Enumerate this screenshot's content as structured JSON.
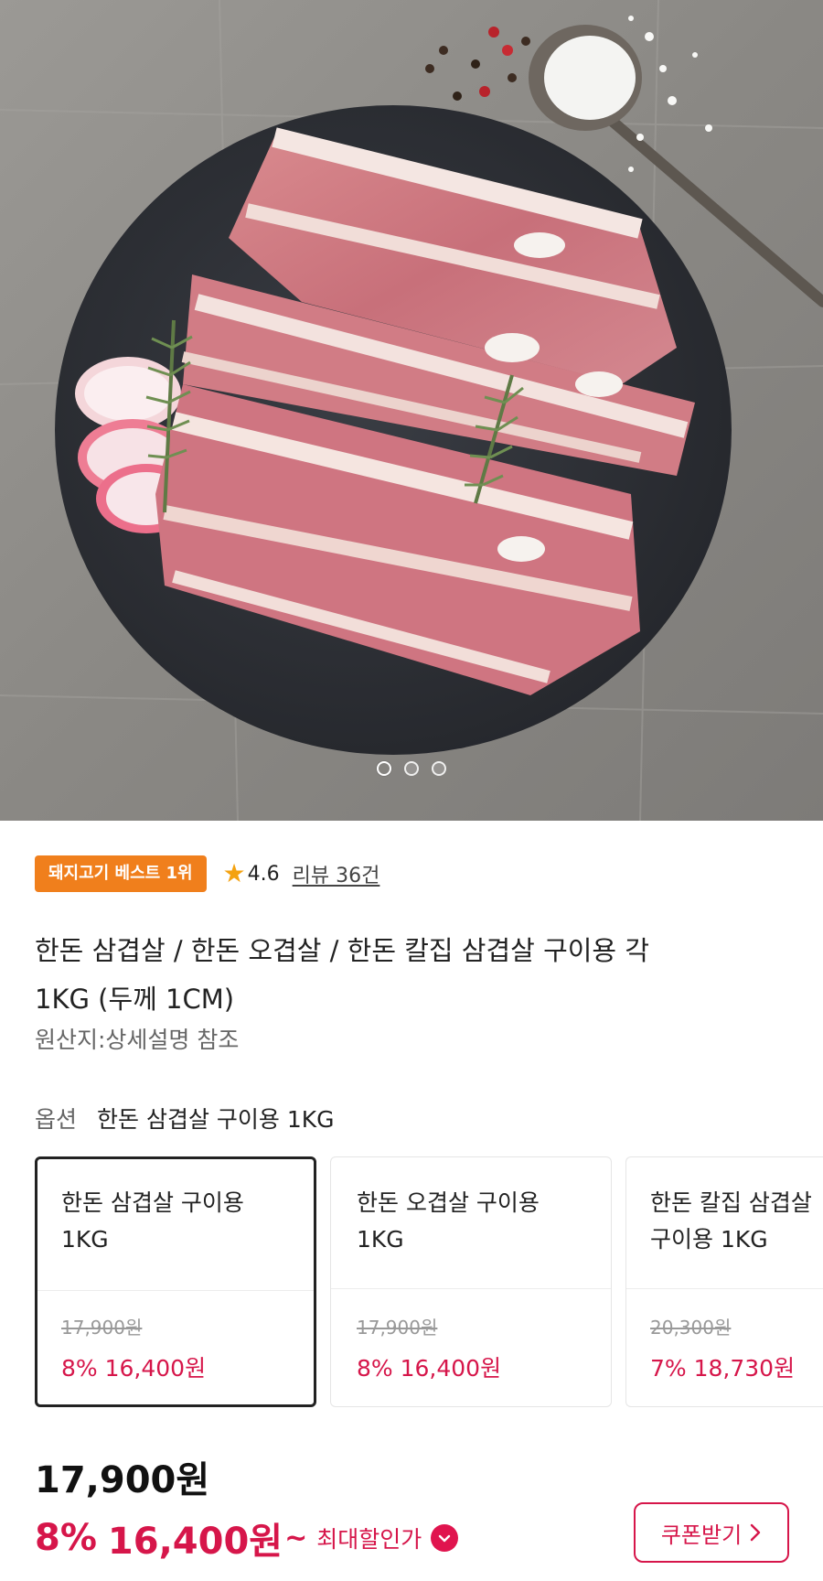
{
  "gallery": {
    "image_alt": "grilled pork belly on slate plate",
    "dots": [
      true,
      false,
      false
    ]
  },
  "product": {
    "badge": "돼지고기 베스트 1위",
    "rating": "4.6",
    "review_link": "리뷰 36건",
    "title_line1": "한돈 삼겹살 / 한돈 오겹살 / 한돈 칼집 삼겹살  구이용 각",
    "title_line2": "1KG (두께 1CM)",
    "origin": "원산지:상세설명 참조"
  },
  "option": {
    "label": "옵션",
    "selected_value": "한돈 삼겹살 구이용 1KG",
    "cards": [
      {
        "name": "한돈 삼겹살 구이용\n1KG",
        "original_price": "17,900원",
        "sale": "8% 16,400원",
        "selected": true
      },
      {
        "name": "한돈 오겹살 구이용\n1KG",
        "original_price": "17,900원",
        "sale": "8% 16,400원",
        "selected": false
      },
      {
        "name": "한돈 칼집 삼겹살\n구이용 1KG",
        "original_price": "20,300원",
        "sale": "7% 18,730원",
        "selected": false
      }
    ]
  },
  "pricing": {
    "price": "17,900원",
    "discount_pct": "8%",
    "discount_price": "16,400원",
    "tilde": "~",
    "max_discount_label": "최대할인가",
    "coupon_button": "쿠폰받기"
  },
  "colors": {
    "accent": "#d6164a",
    "badge": "#f07f1c",
    "star": "#f4a210"
  },
  "icons": [
    "star-icon",
    "chevron-down-icon",
    "chevron-right-icon"
  ]
}
